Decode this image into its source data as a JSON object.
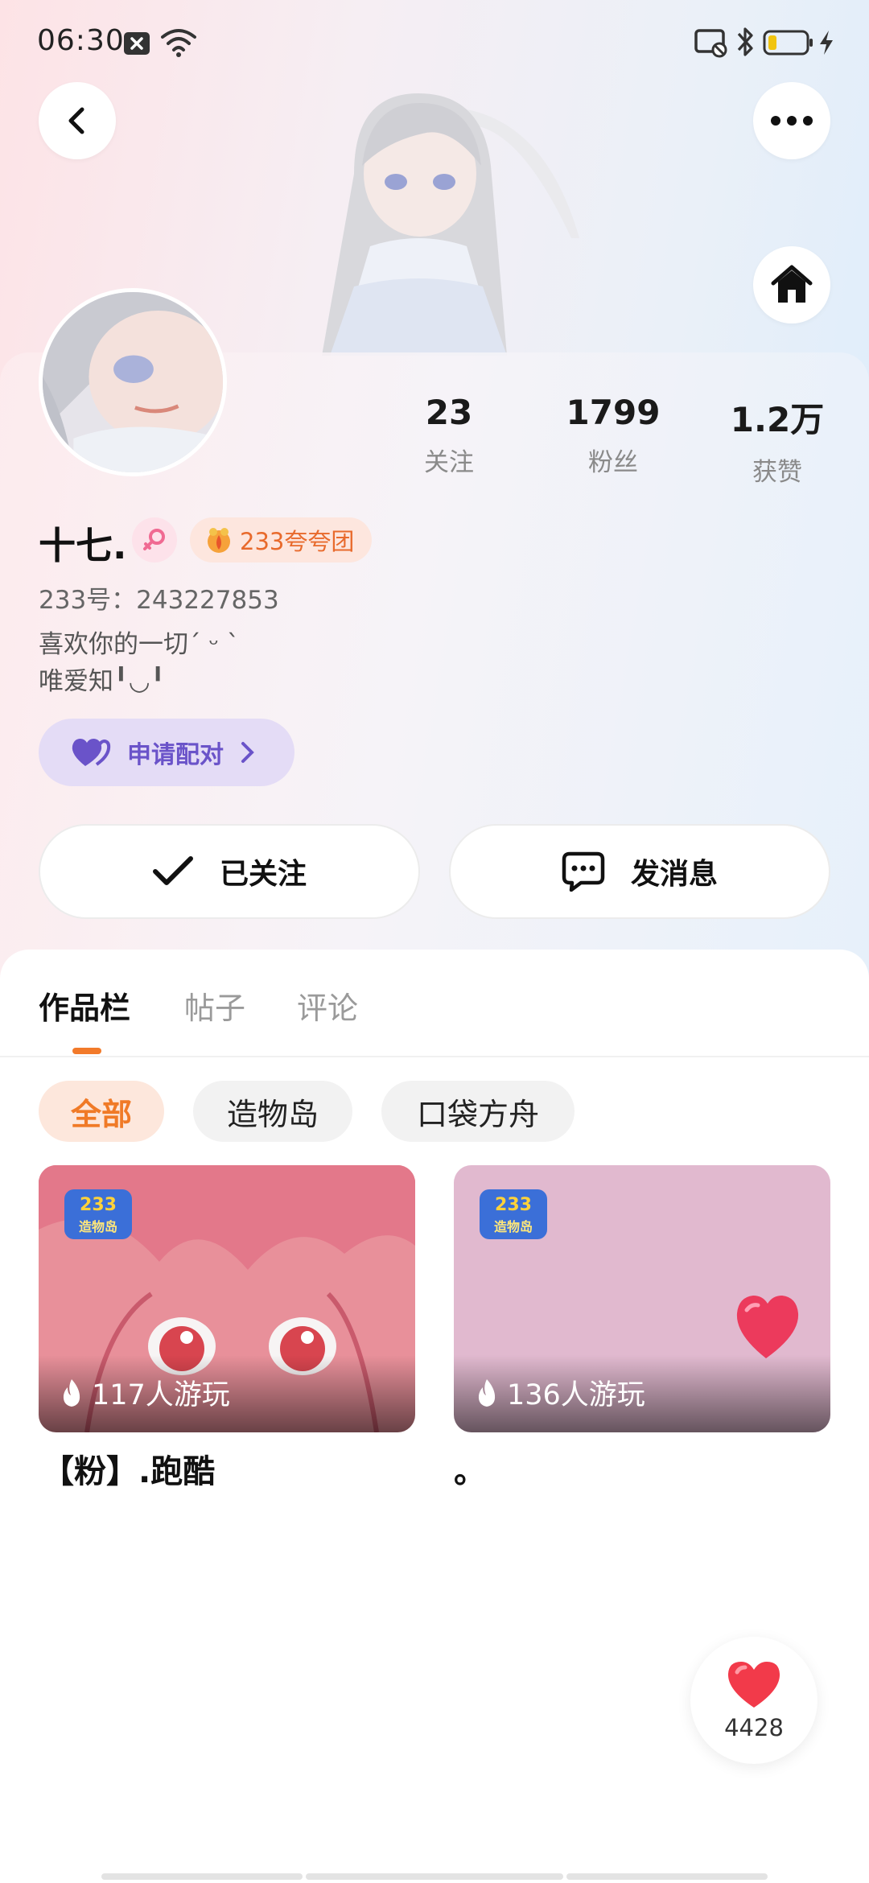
{
  "status_bar": {
    "time": "06:30",
    "icons": [
      "notification-x-icon",
      "wifi-icon",
      "cast-off-icon",
      "bluetooth-icon",
      "battery-low-icon",
      "charging-icon"
    ]
  },
  "nav": {
    "back_icon": "back-chevron-icon",
    "more_icon": "more-dots-icon",
    "home_icon": "home-icon"
  },
  "stats": [
    {
      "value": "23",
      "label": "关注"
    },
    {
      "value": "1799",
      "label": "粉丝"
    },
    {
      "value": "1.2万",
      "label": "获赞"
    }
  ],
  "profile": {
    "name": "十七.",
    "club_badge": "233夸夸团",
    "id_line": "233号：243227853",
    "bio_lines": [
      "喜欢你的一切ˊ ᵕ ˋ",
      "唯爱知╹◡╹"
    ],
    "pair_button": "申请配对"
  },
  "actions": {
    "follow_label": "已关注",
    "message_label": "发消息"
  },
  "tabs": [
    {
      "label": "作品栏",
      "active": true
    },
    {
      "label": "帖子",
      "active": false
    },
    {
      "label": "评论",
      "active": false
    }
  ],
  "filters": [
    {
      "label": "全部",
      "active": true
    },
    {
      "label": "造物岛",
      "active": false
    },
    {
      "label": "口袋方舟",
      "active": false
    }
  ],
  "works": [
    {
      "title": "【粉】.跑酷",
      "plays": "117人游玩",
      "logo_text": "233 造物岛"
    },
    {
      "title": "。",
      "plays": "136人游玩",
      "logo_text": "233 造物岛"
    }
  ],
  "like_fab": {
    "count": "4428"
  },
  "colors": {
    "accent_orange": "#f27a2a",
    "pair_purple": "#6a53c9",
    "heart_red": "#f23a4a"
  }
}
